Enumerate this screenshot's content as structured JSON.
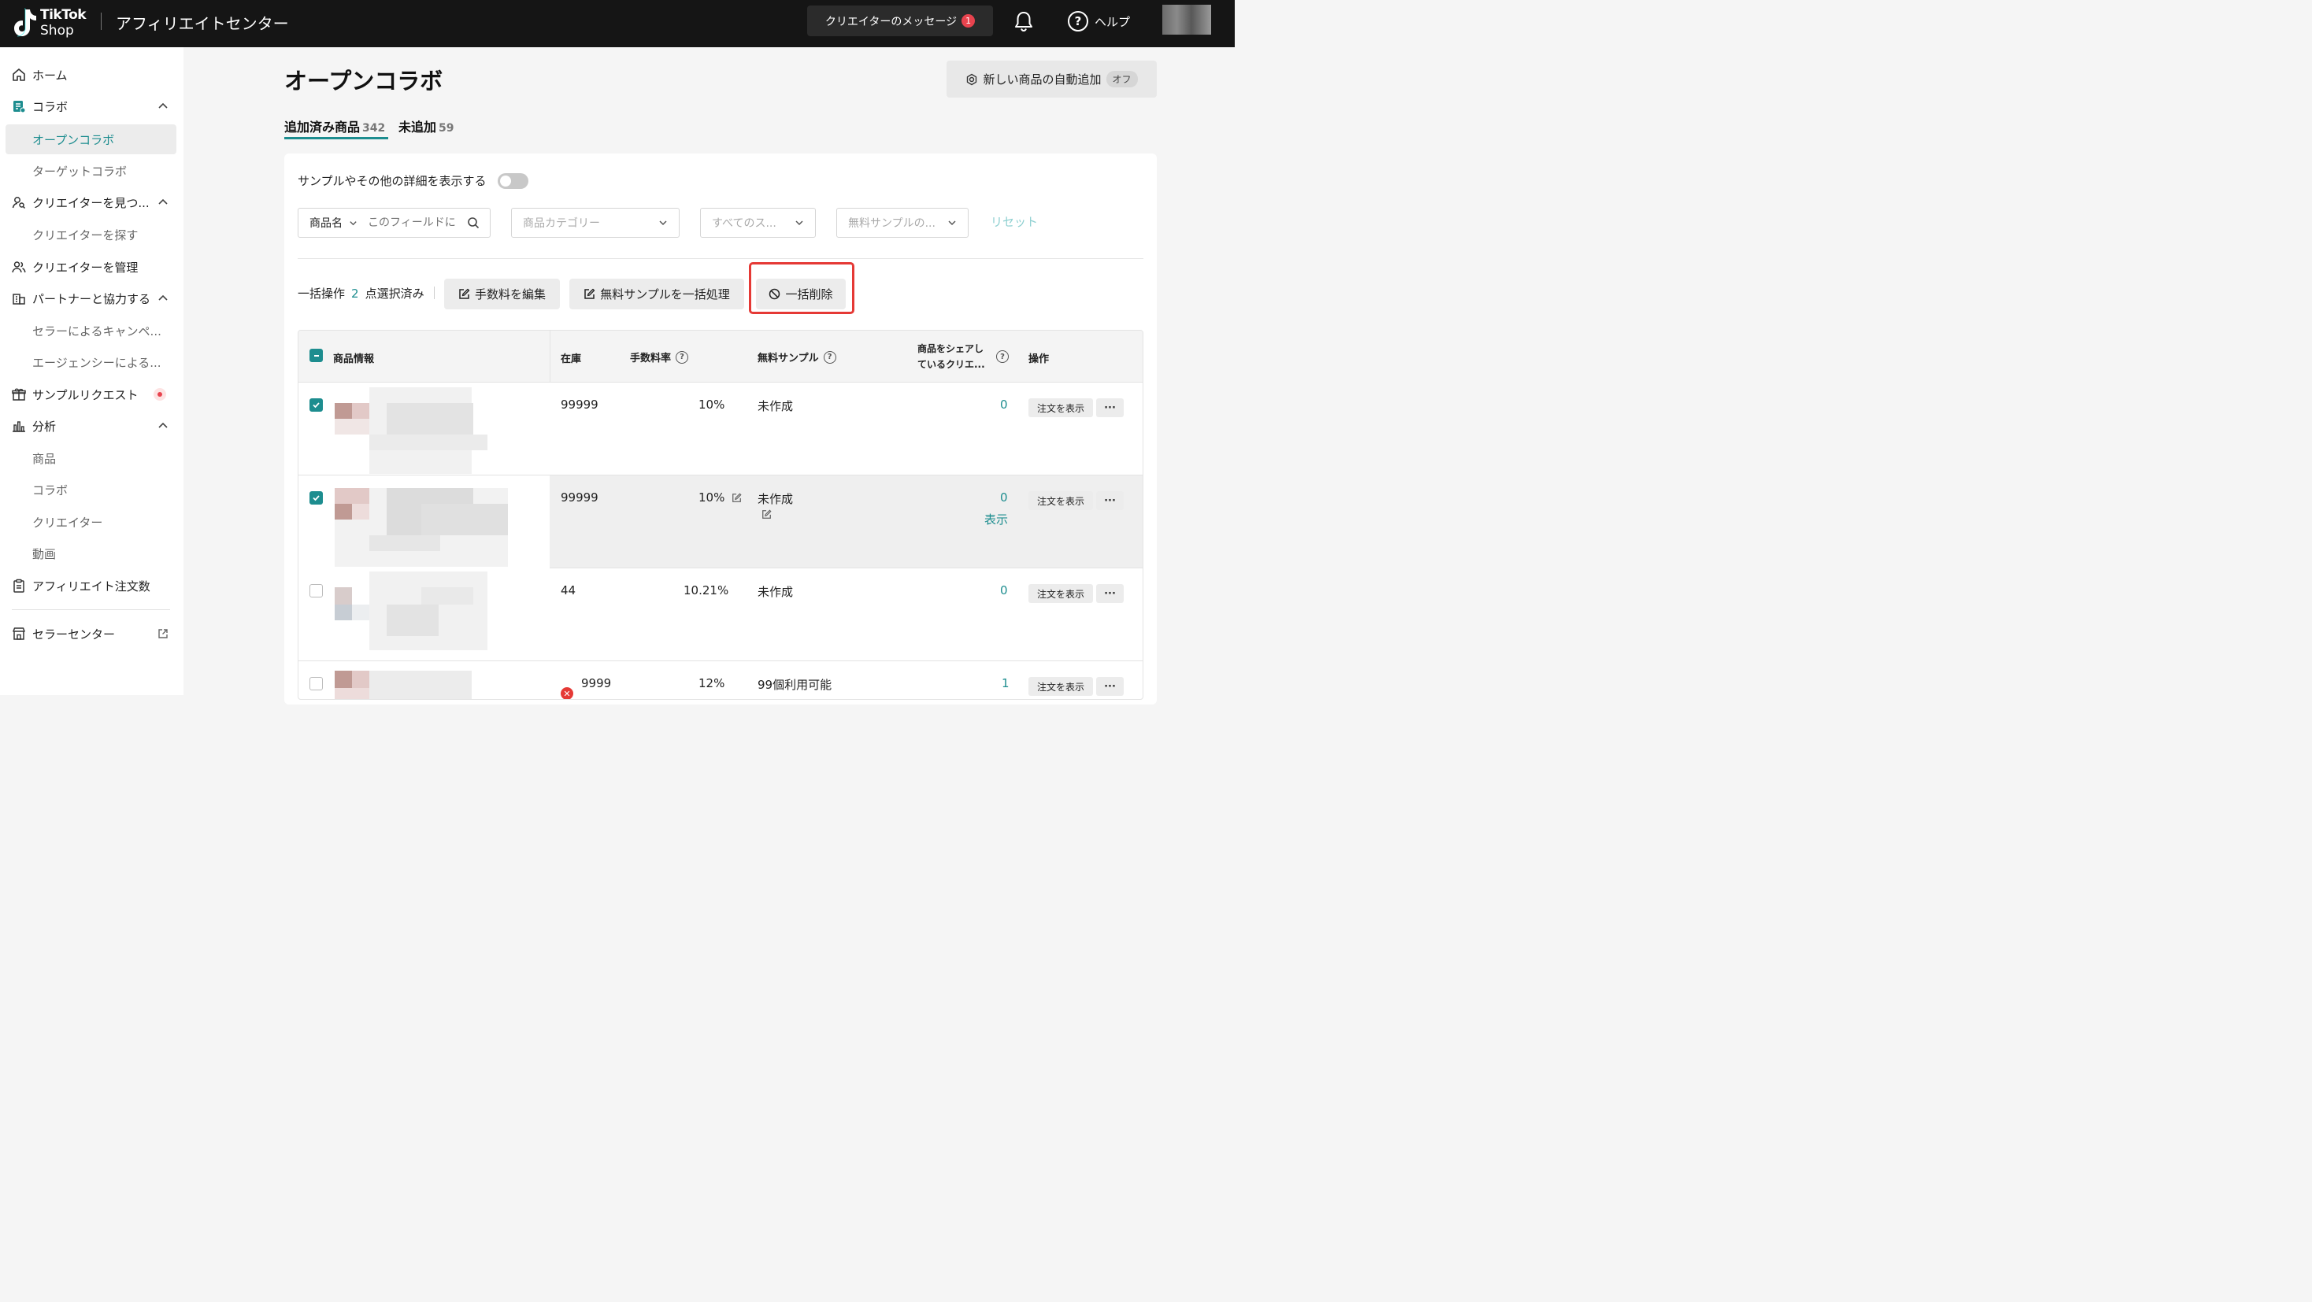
{
  "topbar": {
    "logo_line1": "TikTok",
    "logo_line2": "Shop",
    "app_title": "アフィリエイトセンター",
    "creator_messages": "クリエイターのメッセージ",
    "message_count": "1",
    "help": "ヘルプ"
  },
  "sidebar": {
    "home": "ホーム",
    "collab": "コラボ",
    "open_collab": "オープンコラボ",
    "target_collab": "ターゲットコラボ",
    "find_creators_group": "クリエイターを見つ...",
    "find_creators": "クリエイターを探す",
    "manage_creators": "クリエイターを管理",
    "partners": "パートナーと協力する",
    "seller_campaigns": "セラーによるキャンペ...",
    "agency": "エージェンシーによる...",
    "sample_requests": "サンプルリクエスト",
    "analytics": "分析",
    "analytics_products": "商品",
    "analytics_collab": "コラボ",
    "analytics_creators": "クリエイター",
    "analytics_videos": "動画",
    "affiliate_orders": "アフィリエイト注文数",
    "seller_center": "セラーセンター"
  },
  "main": {
    "title": "オープンコラボ",
    "auto_add": "新しい商品の自動追加",
    "auto_add_state": "オフ",
    "tabs": [
      {
        "label": "追加済み商品",
        "count": "342"
      },
      {
        "label": "未追加",
        "count": "59"
      }
    ],
    "toggle_label": "サンプルやその他の詳細を表示する",
    "filters": {
      "search_field": "商品名",
      "search_placeholder": "このフィールドに",
      "category": "商品カテゴリー",
      "status": "すべてのス...",
      "sample": "無料サンプルの...",
      "reset": "リセット"
    },
    "bulk": {
      "label": "一括操作",
      "count": "2",
      "selected": "点選択済み",
      "edit_commission": "手数料を編集",
      "bulk_sample": "無料サンプルを一括処理",
      "bulk_delete": "一括削除"
    }
  },
  "table": {
    "headers": {
      "product": "商品情報",
      "stock": "在庫",
      "commission": "手数料率",
      "sample": "無料サンプル",
      "sharing_line1": "商品をシェアし",
      "sharing_line2": "ているクリエ...",
      "actions": "操作"
    },
    "view_orders": "注文を表示",
    "more": "···",
    "rows": [
      {
        "stock": "99999",
        "commission": "10%",
        "sample": "未作成",
        "creators": "0",
        "view": ""
      },
      {
        "stock": "99999",
        "commission": "10%",
        "sample": "未作成",
        "creators": "0",
        "view": "表示"
      },
      {
        "stock": "44",
        "commission": "10.21%",
        "sample": "未作成",
        "creators": "0",
        "view": ""
      },
      {
        "stock": "9999",
        "commission": "12%",
        "sample": "99個利用可能",
        "creators": "1",
        "view": ""
      }
    ]
  },
  "colors": {
    "accent": "#1d8d8f",
    "topbar": "#151515",
    "highlight_box": "#e53935",
    "notification": "#e8434e"
  }
}
